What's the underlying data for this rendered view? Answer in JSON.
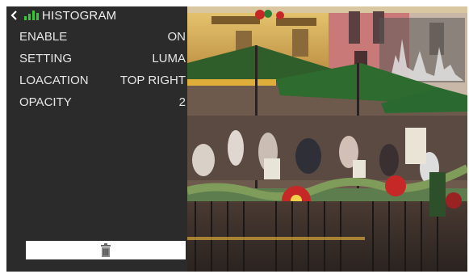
{
  "header": {
    "title": "HISTOGRAM"
  },
  "settings": {
    "rows": [
      {
        "label": "ENABLE",
        "value": "ON"
      },
      {
        "label": "SETTING",
        "value": "LUMA"
      },
      {
        "label": "LOACATION",
        "value": "TOP RIGHT"
      },
      {
        "label": "OPACITY",
        "value": "2"
      }
    ]
  },
  "icons": {
    "back": "chevron-left-icon",
    "histogram": "histogram-bars-icon",
    "delete": "trash-icon"
  },
  "colors": {
    "panel": "#2b2b2b",
    "accent": "#3cc43c",
    "text": "#e6e6e6"
  }
}
